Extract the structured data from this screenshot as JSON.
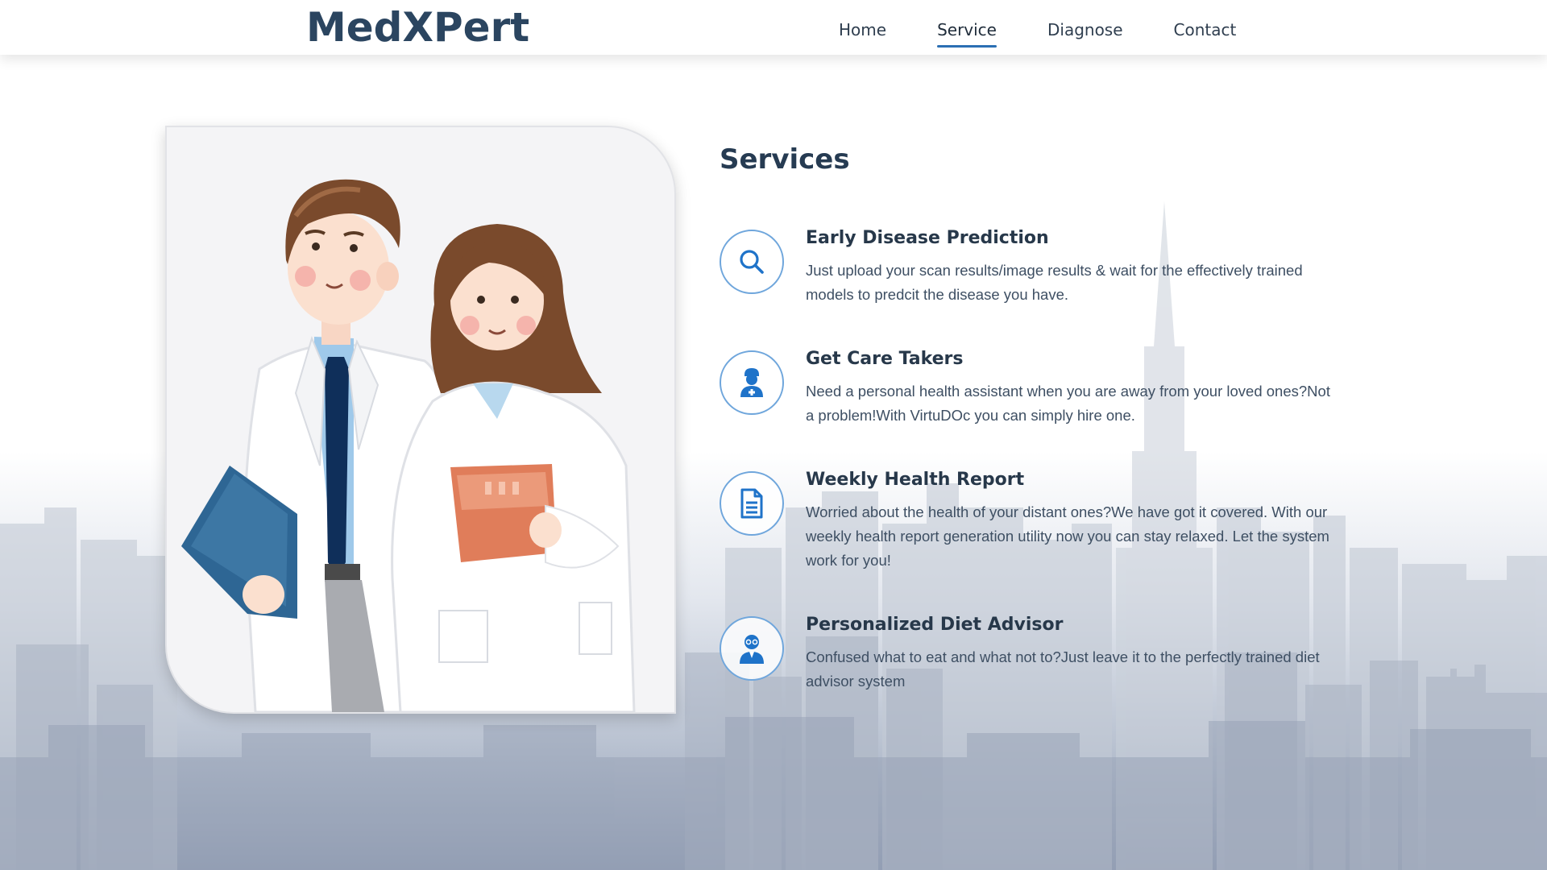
{
  "header": {
    "logo": "MedXPert",
    "nav": [
      {
        "label": "Home",
        "active": false
      },
      {
        "label": "Service",
        "active": true
      },
      {
        "label": "Diagnose",
        "active": false
      },
      {
        "label": "Contact",
        "active": false
      }
    ]
  },
  "hero": {
    "image_icon": "doctors-illustration"
  },
  "services": {
    "title": "Services",
    "items": [
      {
        "icon": "search-icon",
        "heading": "Early Disease Prediction",
        "description": "Just upload your scan results/image results & wait for the effectively trained models to predcit the disease you have."
      },
      {
        "icon": "nurse-icon",
        "heading": "Get Care Takers",
        "description": "Need a personal health assistant when you are away from your loved ones?Not a problem!With VirtuDOc you can simply hire one."
      },
      {
        "icon": "document-icon",
        "heading": "Weekly Health Report",
        "description": "Worried about the health of your distant ones?We have got it covered. With our weekly health report generation utility now you can stay relaxed. Let the system work for you!"
      },
      {
        "icon": "doctor-icon",
        "heading": "Personalized Diet Advisor",
        "description": "Confused what to eat and what not to?Just leave it to the perfectly trained diet advisor system"
      }
    ]
  },
  "colors": {
    "brand": "#2b4560",
    "accent": "#2b6fb3",
    "icon": "#1f73c9"
  }
}
